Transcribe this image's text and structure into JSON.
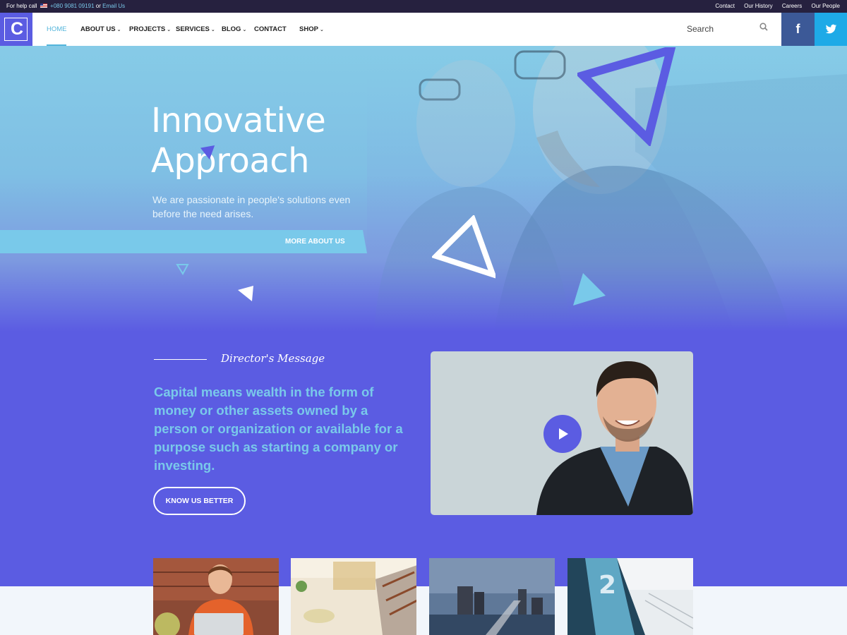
{
  "topbar": {
    "help_prefix": "For help call",
    "phone": "+080 9081 09191",
    "or": "or",
    "email_link": "Email Us",
    "links": [
      "Contact",
      "Our History",
      "Careers",
      "Our People"
    ]
  },
  "nav": {
    "logo_letter": "C",
    "items": [
      {
        "label": "HOME",
        "caret": ""
      },
      {
        "label": "ABOUT US",
        "caret": "⌄"
      },
      {
        "label": "PROJECTS",
        "caret": "⌄"
      },
      {
        "label": "SERVICES",
        "caret": "⌄"
      },
      {
        "label": "BLOG",
        "caret": "⌄"
      },
      {
        "label": "CONTACT",
        "caret": ""
      },
      {
        "label": "SHOP",
        "caret": "⌄"
      }
    ],
    "search_placeholder": "Search",
    "facebook_glyph": "f"
  },
  "hero": {
    "title_line1": "Innovative",
    "title_line2": "Approach",
    "subtitle": "We are passionate in people's solutions even before the need arises.",
    "cta": "MORE ABOUT US"
  },
  "director": {
    "label": "Director's Message",
    "text": "Capital means wealth in the form of money or other assets owned by a person or organization or available for a purpose such as starting a company or investing.",
    "cta": "KNOW US BETTER"
  },
  "colors": {
    "primary": "#5b5ce2",
    "accent": "#54b5db",
    "topbar": "#26213f",
    "facebook": "#3c5997",
    "twitter": "#1eaae7"
  },
  "icons": [
    "search-icon",
    "facebook-icon",
    "twitter-icon",
    "play-icon",
    "flag-icon"
  ]
}
